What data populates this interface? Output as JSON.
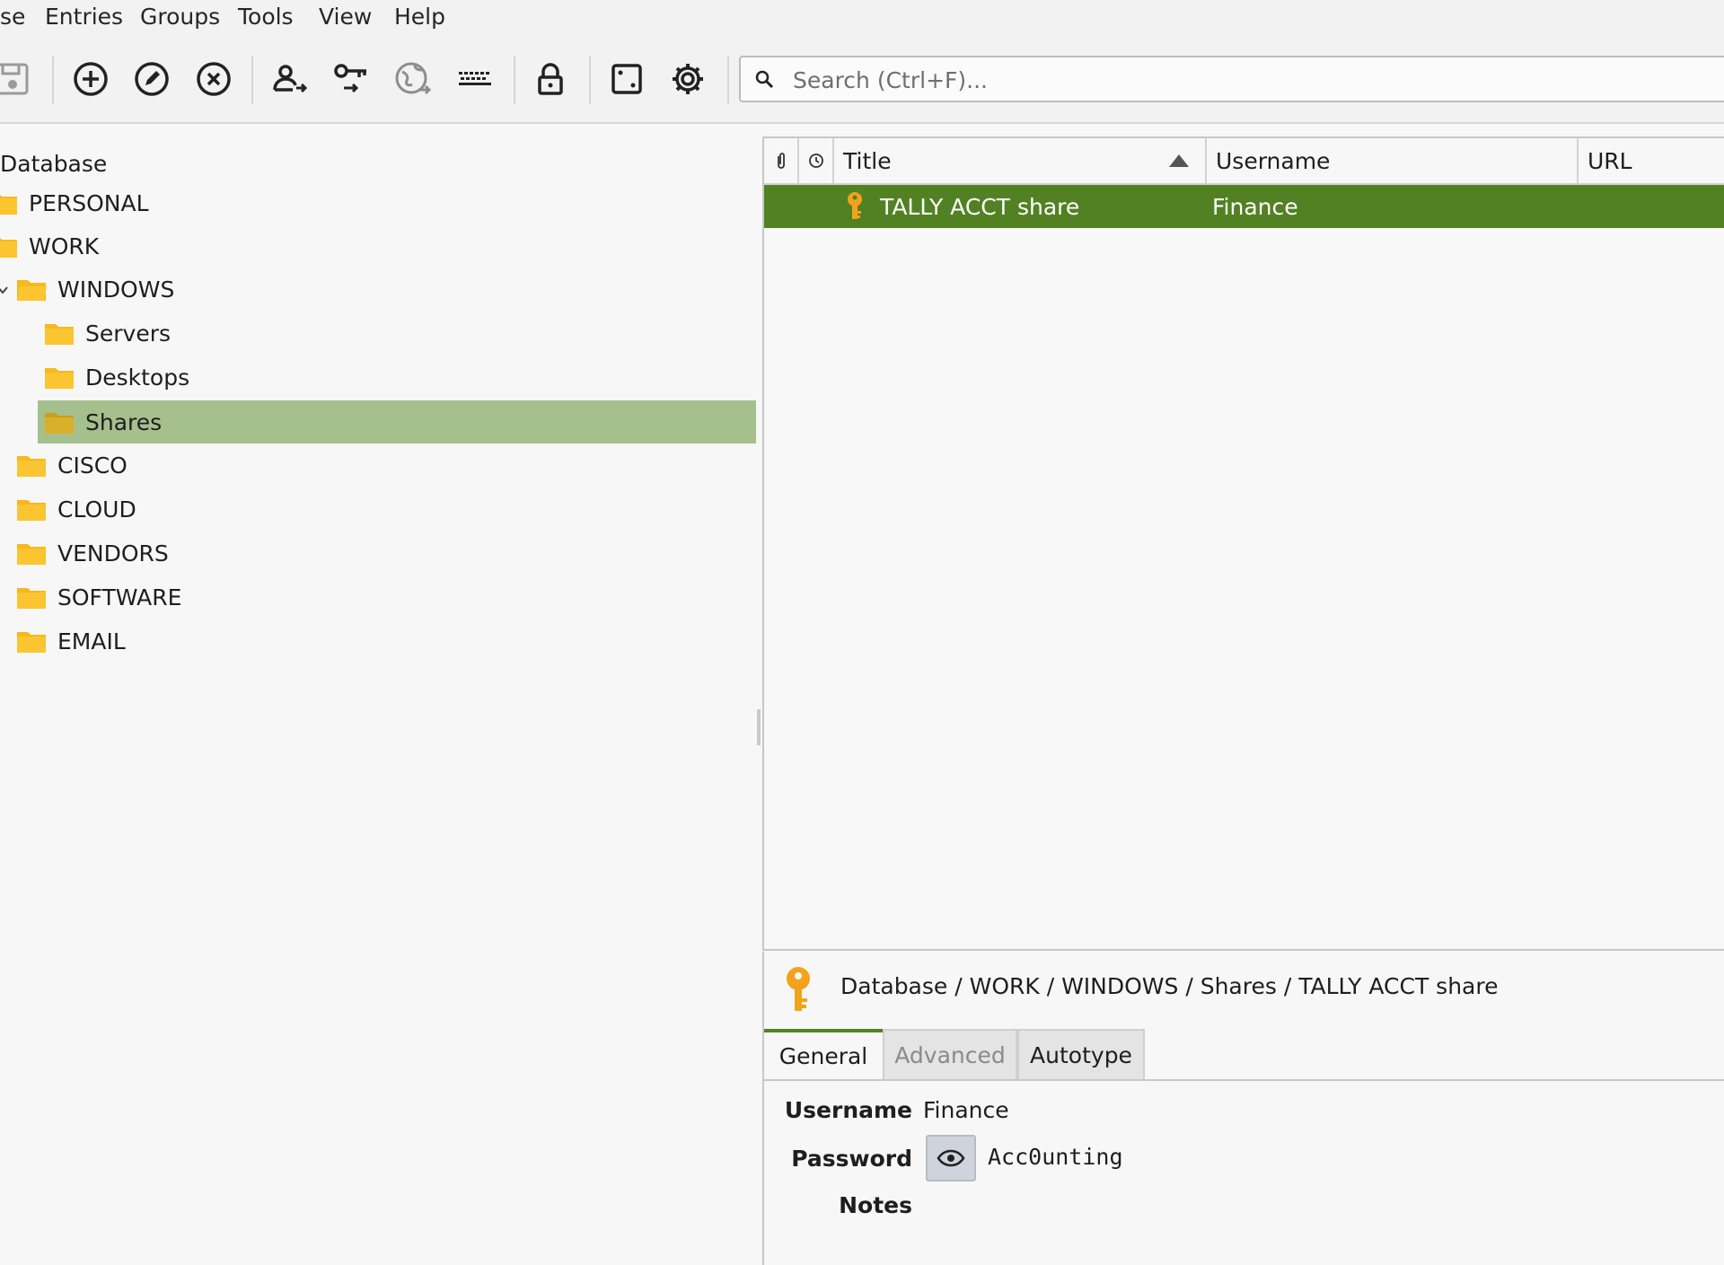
{
  "menu": {
    "items": [
      "se",
      "Entries",
      "Groups",
      "Tools",
      "View",
      "Help"
    ]
  },
  "toolbar": {
    "icons": [
      "save-icon",
      "add-entry-icon",
      "edit-entry-icon",
      "delete-entry-icon",
      "copy-username-icon",
      "copy-password-icon",
      "open-url-icon",
      "autotype-icon",
      "lock-database-icon",
      "password-generator-icon",
      "settings-icon"
    ],
    "search_placeholder": "Search (Ctrl+F)..."
  },
  "tree": {
    "root": "Database",
    "groups": [
      {
        "label": "PERSONAL",
        "level": 0
      },
      {
        "label": "WORK",
        "level": 0
      },
      {
        "label": "WINDOWS",
        "level": 1,
        "expanded": true
      },
      {
        "label": "Servers",
        "level": 2
      },
      {
        "label": "Desktops",
        "level": 2
      },
      {
        "label": "Shares",
        "level": 2,
        "selected": true
      },
      {
        "label": "CISCO",
        "level": 1
      },
      {
        "label": "CLOUD",
        "level": 1
      },
      {
        "label": "VENDORS",
        "level": 1
      },
      {
        "label": "SOFTWARE",
        "level": 1
      },
      {
        "label": "EMAIL",
        "level": 1
      }
    ]
  },
  "table": {
    "columns": {
      "attachment": "attachment-icon",
      "expiry": "clock-icon",
      "title": "Title",
      "username": "Username",
      "url": "URL"
    },
    "sort": {
      "column": "Title",
      "direction": "ascending"
    },
    "rows": [
      {
        "title": "TALLY ACCT share",
        "username": "Finance",
        "url": "",
        "selected": true
      }
    ]
  },
  "preview": {
    "path": "Database / WORK / WINDOWS / Shares / TALLY ACCT share",
    "tabs": [
      "General",
      "Advanced",
      "Autotype"
    ],
    "active_tab": "General",
    "fields": {
      "username_label": "Username",
      "username_value": "Finance",
      "password_label": "Password",
      "password_value": "Acc0unting",
      "notes_label": "Notes"
    }
  },
  "colors": {
    "selection_row": "#528123",
    "selection_tree": "#a5c08d",
    "folder": "#f7b81b",
    "key": "#f2a31b"
  }
}
